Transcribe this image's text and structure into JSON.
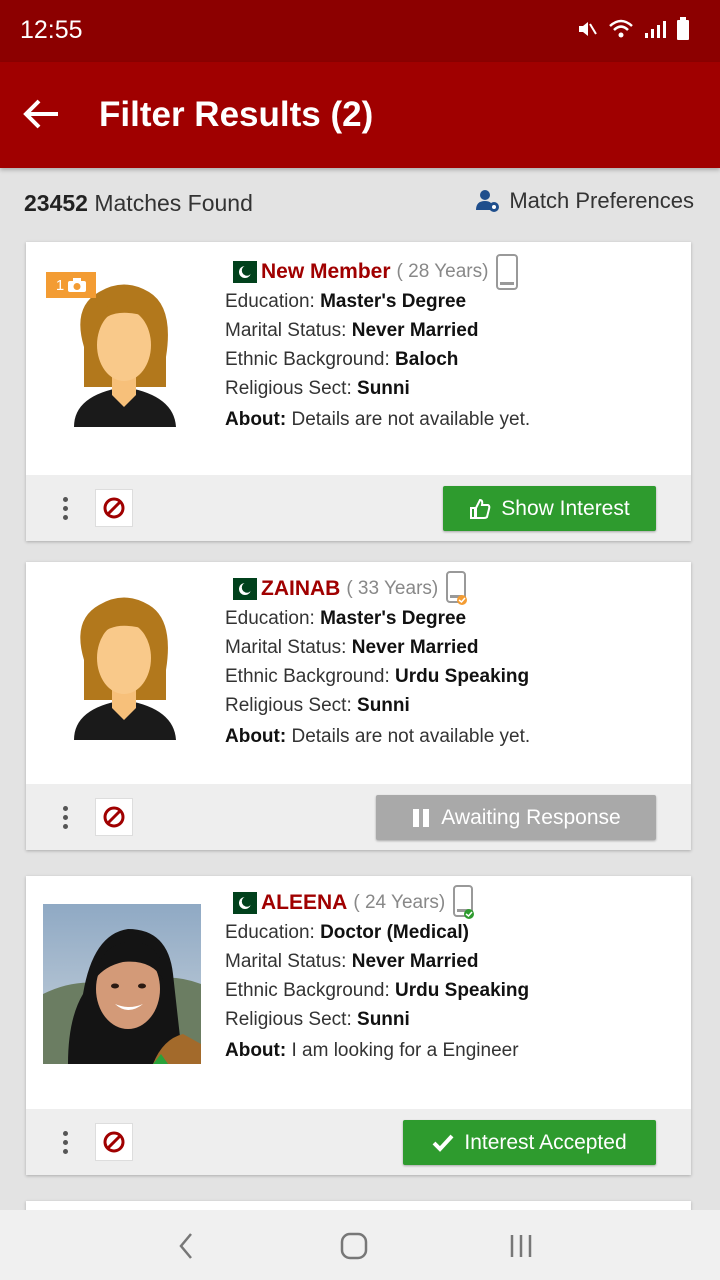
{
  "status_bar": {
    "time": "12:55"
  },
  "app_bar": {
    "title": "Filter Results (2)"
  },
  "summary": {
    "count": "23452",
    "matches_label": "Matches Found",
    "preferences_label": "Match Preferences"
  },
  "labels": {
    "education": "Education:",
    "marital_status": "Marital Status:",
    "ethnic_background": "Ethnic Background:",
    "religious_sect": "Religious Sect:",
    "about": "About:"
  },
  "profiles": [
    {
      "name": "New Member",
      "age": "( 28 Years)",
      "photo_count": "1",
      "education": "Master's Degree",
      "marital_status": "Never Married",
      "ethnic_background": "Baloch",
      "religious_sect": "Sunni",
      "about": "Details are not available yet.",
      "action_label": "Show Interest",
      "action_color": "#2e9b2e"
    },
    {
      "name": "ZAINAB",
      "age": "( 33 Years)",
      "education": "Master's Degree",
      "marital_status": "Never Married",
      "ethnic_background": "Urdu Speaking",
      "religious_sect": "Sunni",
      "about": "Details are not available yet.",
      "action_label": "Awaiting Response",
      "action_color": "#a9a9a9"
    },
    {
      "name": "ALEENA",
      "age": "( 24 Years)",
      "education": "Doctor (Medical)",
      "marital_status": "Never Married",
      "ethnic_background": "Urdu Speaking",
      "religious_sect": "Sunni",
      "about": "I am looking for a Engineer",
      "action_label": "Interest Accepted",
      "action_color": "#2e9b2e"
    }
  ],
  "colors": {
    "status_bar": "#8c0000",
    "app_bar": "#a00000",
    "name": "#a00000",
    "green": "#2e9b2e",
    "orange_badge": "#f39c33"
  }
}
